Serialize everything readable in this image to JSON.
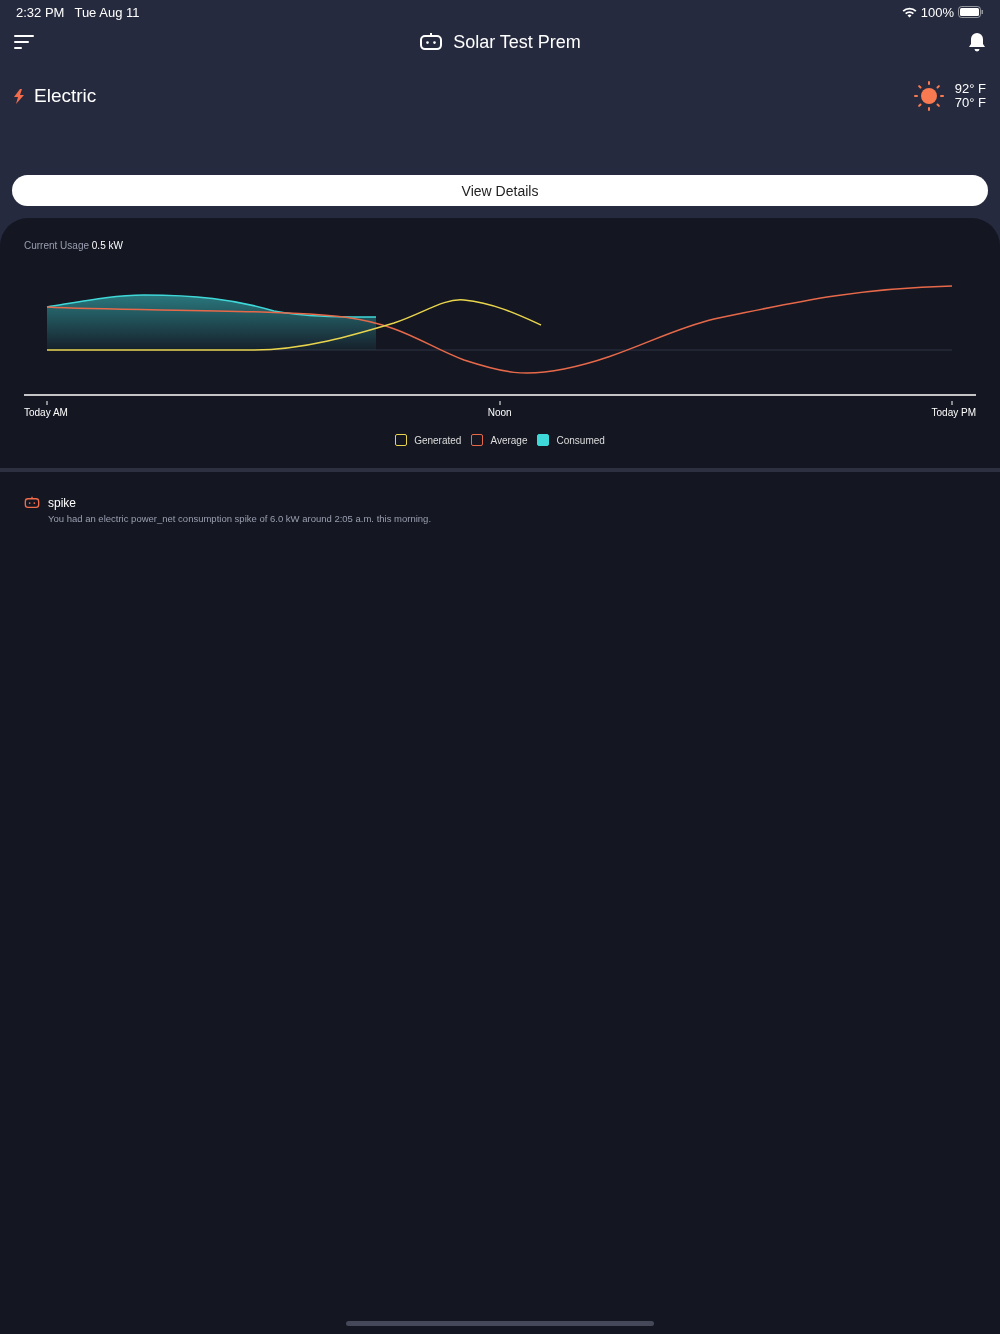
{
  "status_bar": {
    "time": "2:32 PM",
    "date": "Tue Aug 11",
    "battery": "100%"
  },
  "header": {
    "title": "Solar Test Prem"
  },
  "utility": {
    "label": "Electric",
    "temp_high": "92° F",
    "temp_low": "70° F"
  },
  "view_details": "View Details",
  "usage": {
    "label": "Current Usage",
    "value": "0.5 kW"
  },
  "x_labels": [
    "Today AM",
    "Noon",
    "Today PM"
  ],
  "legend": [
    {
      "label": "Generated",
      "color": "#e8d44d",
      "filled": false
    },
    {
      "label": "Average",
      "color": "#e8694a",
      "filled": false
    },
    {
      "label": "Consumed",
      "color": "#3fd8d8",
      "filled": true
    }
  ],
  "alerts": [
    {
      "title": "spike",
      "message": "You had an electric power_net consumption spike of 6.0 kW around 2:05 a.m. this morning."
    }
  ]
}
